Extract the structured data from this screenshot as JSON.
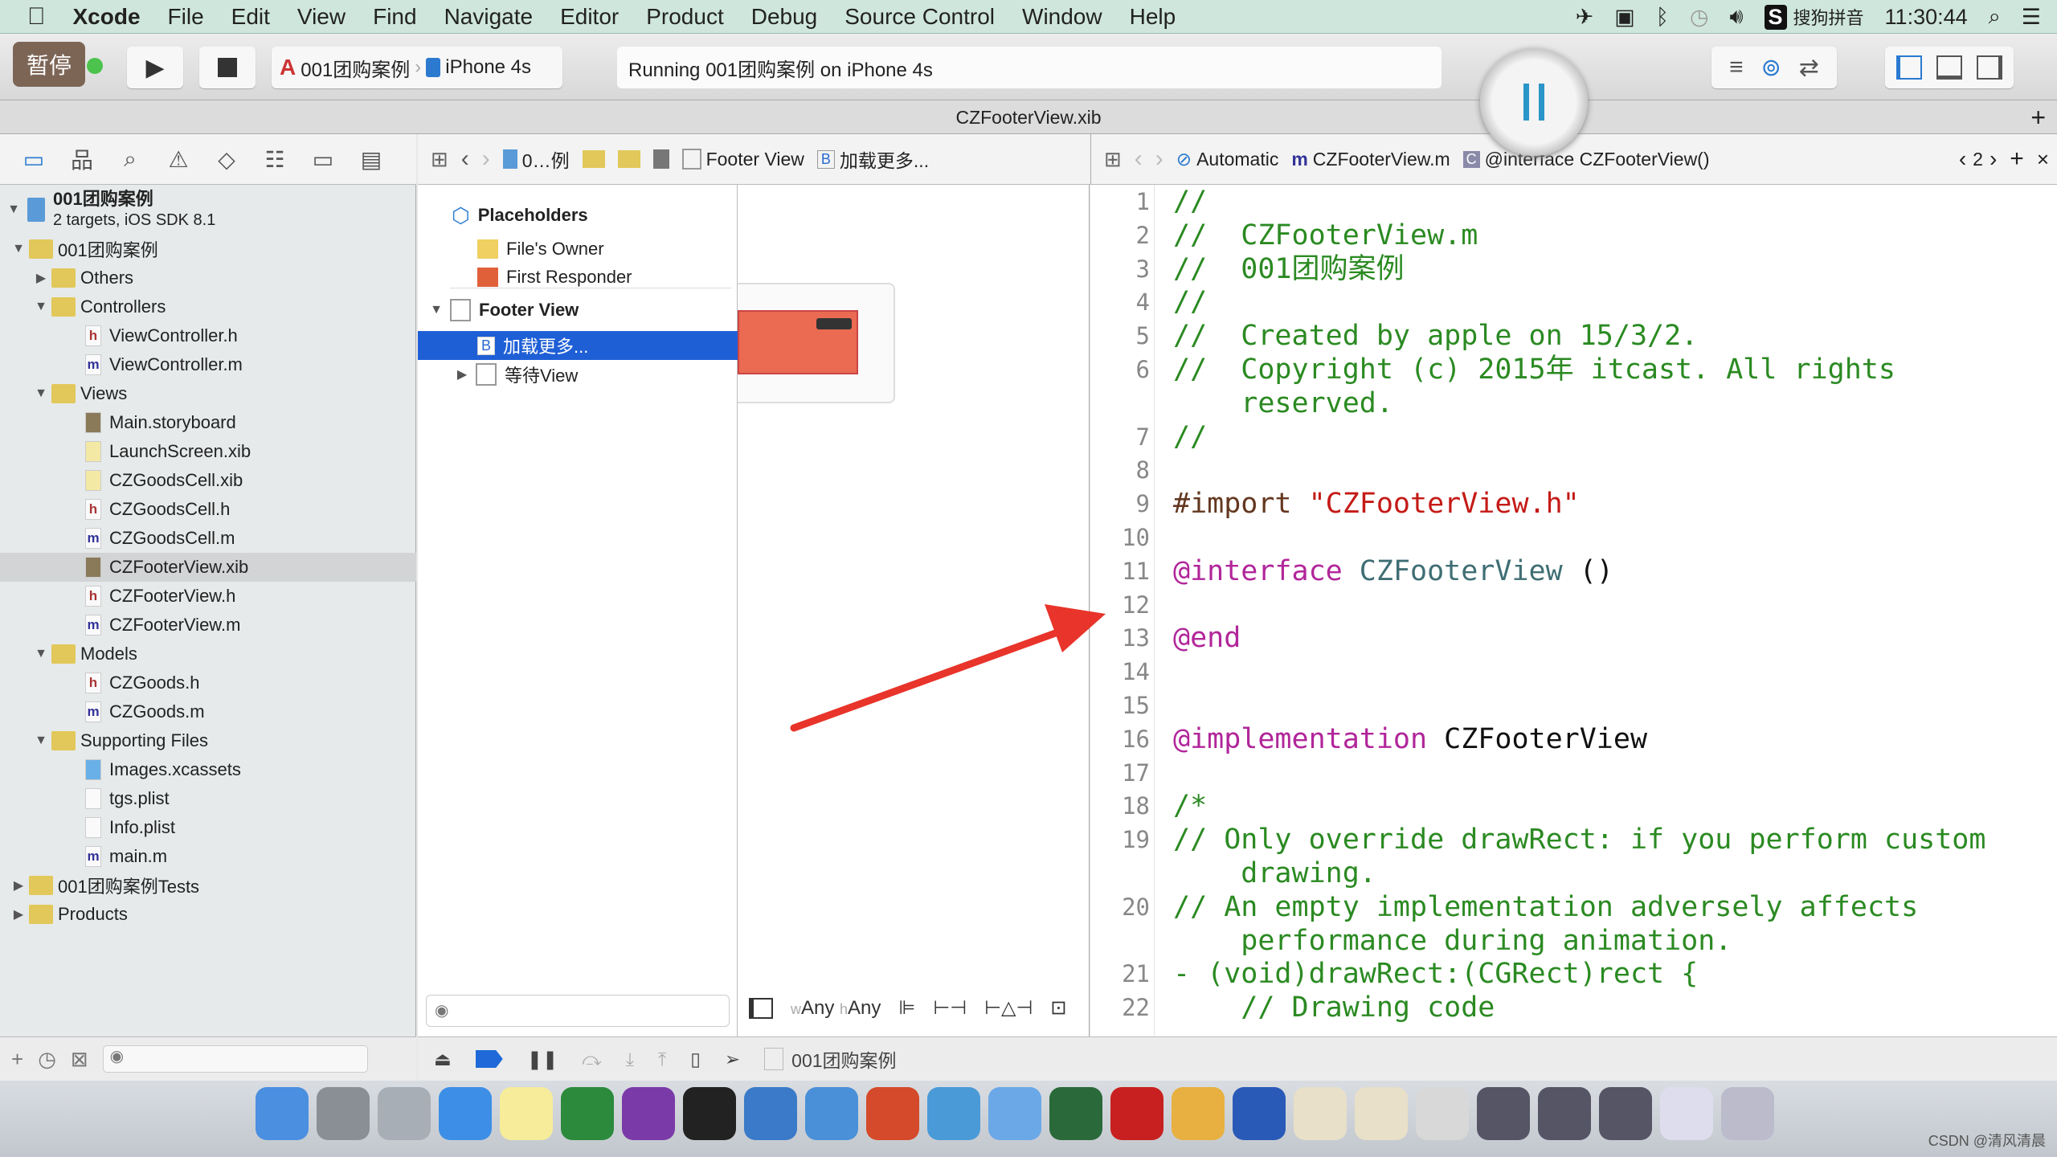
{
  "menubar": {
    "app": "Xcode",
    "items": [
      "File",
      "Edit",
      "View",
      "Find",
      "Navigate",
      "Editor",
      "Product",
      "Debug",
      "Source Control",
      "Window",
      "Help"
    ],
    "input_method": "搜狗拼音",
    "clock": "11:30:44"
  },
  "toolbar": {
    "pause_badge": "暂停",
    "scheme": "001团购案例",
    "device": "iPhone 4s",
    "status": "Running 001团购案例 on iPhone 4s"
  },
  "tab": {
    "title": "CZFooterView.xib"
  },
  "ib_jumpbar": [
    "0…例",
    "Footer View",
    "加载更多..."
  ],
  "editor_jumpbar": {
    "mode": "Automatic",
    "file": "CZFooterView.m",
    "symbol": "@interface CZFooterView()",
    "counterpart_index": "2"
  },
  "navigator": {
    "project": {
      "name": "001团购案例",
      "subtitle": "2 targets, iOS SDK 8.1"
    },
    "rows": [
      {
        "label": "001团购案例",
        "level": 1,
        "kind": "folder",
        "open": true
      },
      {
        "label": "Others",
        "level": 2,
        "kind": "folder",
        "open": false
      },
      {
        "label": "Controllers",
        "level": 2,
        "kind": "folder",
        "open": true
      },
      {
        "label": "ViewController.h",
        "level": 3,
        "kind": "h"
      },
      {
        "label": "ViewController.m",
        "level": 3,
        "kind": "m"
      },
      {
        "label": "Views",
        "level": 2,
        "kind": "folder",
        "open": true
      },
      {
        "label": "Main.storyboard",
        "level": 3,
        "kind": "sb"
      },
      {
        "label": "LaunchScreen.xib",
        "level": 3,
        "kind": "xib"
      },
      {
        "label": "CZGoodsCell.xib",
        "level": 3,
        "kind": "xib"
      },
      {
        "label": "CZGoodsCell.h",
        "level": 3,
        "kind": "h"
      },
      {
        "label": "CZGoodsCell.m",
        "level": 3,
        "kind": "m"
      },
      {
        "label": "CZFooterView.xib",
        "level": 3,
        "kind": "sb",
        "selected": true
      },
      {
        "label": "CZFooterView.h",
        "level": 3,
        "kind": "h"
      },
      {
        "label": "CZFooterView.m",
        "level": 3,
        "kind": "m"
      },
      {
        "label": "Models",
        "level": 2,
        "kind": "folder",
        "open": true
      },
      {
        "label": "CZGoods.h",
        "level": 3,
        "kind": "h"
      },
      {
        "label": "CZGoods.m",
        "level": 3,
        "kind": "m"
      },
      {
        "label": "Supporting Files",
        "level": 2,
        "kind": "folder",
        "open": true
      },
      {
        "label": "Images.xcassets",
        "level": 3,
        "kind": "assets"
      },
      {
        "label": "tgs.plist",
        "level": 3,
        "kind": "plist"
      },
      {
        "label": "Info.plist",
        "level": 3,
        "kind": "plist"
      },
      {
        "label": "main.m",
        "level": 3,
        "kind": "m"
      },
      {
        "label": "001团购案例Tests",
        "level": 1,
        "kind": "folder",
        "open": false
      },
      {
        "label": "Products",
        "level": 1,
        "kind": "folder",
        "open": false
      }
    ]
  },
  "outline": {
    "placeholders": "Placeholders",
    "files_owner": "File's Owner",
    "first_responder": "First Responder",
    "root": "Footer View",
    "selected_child": "加载更多...",
    "child2": "等待View"
  },
  "canvas": {
    "size_w": "Any",
    "size_h": "Any",
    "w_prefix": "w",
    "h_prefix": "h"
  },
  "debugbar": {
    "process": "001团购案例"
  },
  "code": [
    {
      "n": "1",
      "t": [
        [
          "//",
          "comment"
        ]
      ]
    },
    {
      "n": "2",
      "t": [
        [
          "//  CZFooterView.m",
          "comment"
        ]
      ]
    },
    {
      "n": "3",
      "t": [
        [
          "//  001团购案例",
          "comment"
        ]
      ]
    },
    {
      "n": "4",
      "t": [
        [
          "//",
          "comment"
        ]
      ]
    },
    {
      "n": "5",
      "t": [
        [
          "//  Created by apple on 15/3/2.",
          "comment"
        ]
      ]
    },
    {
      "n": "6",
      "t": [
        [
          "//  Copyright (c) 2015年 itcast. All rights",
          "comment"
        ]
      ]
    },
    {
      "n": "",
      "t": [
        [
          "    reserved.",
          "comment"
        ]
      ]
    },
    {
      "n": "7",
      "t": [
        [
          "//",
          "comment"
        ]
      ]
    },
    {
      "n": "8",
      "t": []
    },
    {
      "n": "9",
      "t": [
        [
          "#import ",
          "pre"
        ],
        [
          "\"CZFooterView.h\"",
          "str"
        ]
      ]
    },
    {
      "n": "10",
      "t": []
    },
    {
      "n": "11",
      "t": [
        [
          "@interface ",
          "kw"
        ],
        [
          "CZFooterView",
          "type"
        ],
        [
          " ()",
          "plain"
        ]
      ]
    },
    {
      "n": "12",
      "t": []
    },
    {
      "n": "13",
      "t": [
        [
          "@end",
          "kw"
        ]
      ]
    },
    {
      "n": "14",
      "t": []
    },
    {
      "n": "15",
      "t": []
    },
    {
      "n": "16",
      "t": [
        [
          "@implementation ",
          "kw"
        ],
        [
          "CZFooterView",
          "plain"
        ]
      ]
    },
    {
      "n": "17",
      "t": []
    },
    {
      "n": "18",
      "t": [
        [
          "/*",
          "comment"
        ]
      ]
    },
    {
      "n": "19",
      "t": [
        [
          "// Only override drawRect: if you perform custom",
          "comment"
        ]
      ]
    },
    {
      "n": "",
      "t": [
        [
          "    drawing.",
          "comment"
        ]
      ]
    },
    {
      "n": "20",
      "t": [
        [
          "// An empty implementation adversely affects",
          "comment"
        ]
      ]
    },
    {
      "n": "",
      "t": [
        [
          "    performance during animation.",
          "comment"
        ]
      ]
    },
    {
      "n": "21",
      "t": [
        [
          "- (void)drawRect:(CGRect)rect {",
          "comment"
        ]
      ]
    },
    {
      "n": "22",
      "t": [
        [
          "    // Drawing code",
          "comment"
        ]
      ]
    }
  ],
  "colors": {
    "selection": "#1f5fd6",
    "annotation_arrow": "#e8342a",
    "comment": "#2b8a22",
    "keyword": "#b1269a",
    "string": "#c41a16",
    "ib_button": "#ea6a52"
  },
  "dock": [
    "finder",
    "system-preferences",
    "launchpad",
    "safari",
    "notes",
    "excel",
    "onenote",
    "terminal",
    "xcode",
    "preview",
    "powerpoint",
    "screenshot",
    "keynote",
    "sourcetree",
    "filezilla",
    "instruments",
    "word",
    "pages",
    "keynote-2",
    "clipboard",
    "network-1",
    "network-2",
    "network-3",
    "drive",
    "trash"
  ],
  "watermark": "CSDN @清风清晨"
}
